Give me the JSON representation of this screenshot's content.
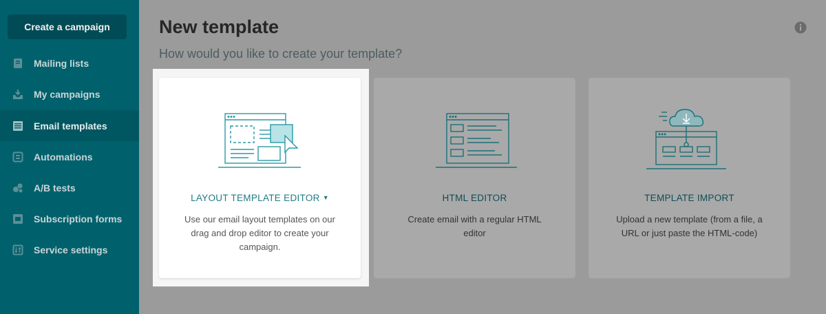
{
  "sidebar": {
    "create_button": "Create a campaign",
    "items": [
      {
        "label": "Mailing lists",
        "icon": "address-book-icon"
      },
      {
        "label": "My campaigns",
        "icon": "campaigns-icon"
      },
      {
        "label": "Email templates",
        "icon": "templates-icon",
        "active": true
      },
      {
        "label": "Automations",
        "icon": "automation-icon"
      },
      {
        "label": "A/B tests",
        "icon": "ab-test-icon"
      },
      {
        "label": "Subscription forms",
        "icon": "forms-icon"
      },
      {
        "label": "Service settings",
        "icon": "settings-icon"
      }
    ]
  },
  "header": {
    "title": "New template",
    "subtitle": "How would you like to create your template?",
    "info_icon": "info-icon"
  },
  "options": [
    {
      "title": "LAYOUT TEMPLATE EDITOR",
      "has_dropdown": true,
      "description": "Use our email layout templates on our drag and drop editor to create your campaign.",
      "icon": "layout-editor-illustration",
      "highlighted": true
    },
    {
      "title": "HTML EDITOR",
      "description": "Create email with a regular HTML editor",
      "icon": "html-editor-illustration"
    },
    {
      "title": "TEMPLATE IMPORT",
      "description": "Upload a new template (from a file, a URL or just paste the HTML-code)",
      "icon": "cloud-import-illustration"
    }
  ],
  "colors": {
    "sidebar": "#00616c",
    "accent": "#1f7b85",
    "overlay": "#9b9b9b"
  }
}
